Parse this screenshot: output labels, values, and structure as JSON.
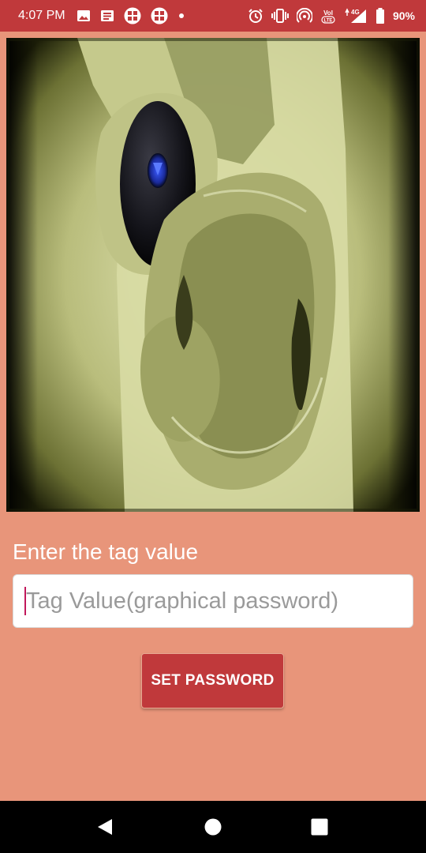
{
  "status_bar": {
    "time": "4:07 PM",
    "battery_percent": "90%",
    "network": "4G",
    "volte": "VoLTE",
    "left_icons": [
      "image-icon",
      "message-icon",
      "app-grid-icon",
      "app-grid-icon",
      "dot-icon"
    ],
    "right_icons": [
      "alarm-icon",
      "vibrate-icon",
      "hotspot-icon",
      "volte-icon",
      "signal-icon",
      "battery-icon"
    ]
  },
  "hero_image": {
    "description_icon": "magic-8-ball-photo"
  },
  "form": {
    "label": "Enter the tag value",
    "input_placeholder": "Tag Value(graphical password)",
    "input_value": "",
    "button_label": "SET PASSWORD"
  },
  "nav_bar": {
    "buttons": [
      "back-icon",
      "home-icon",
      "recents-icon"
    ]
  },
  "colors": {
    "status_bar": "#C0393B",
    "background": "#E8957A",
    "button": "#C0393B",
    "caret": "#C2185B"
  }
}
